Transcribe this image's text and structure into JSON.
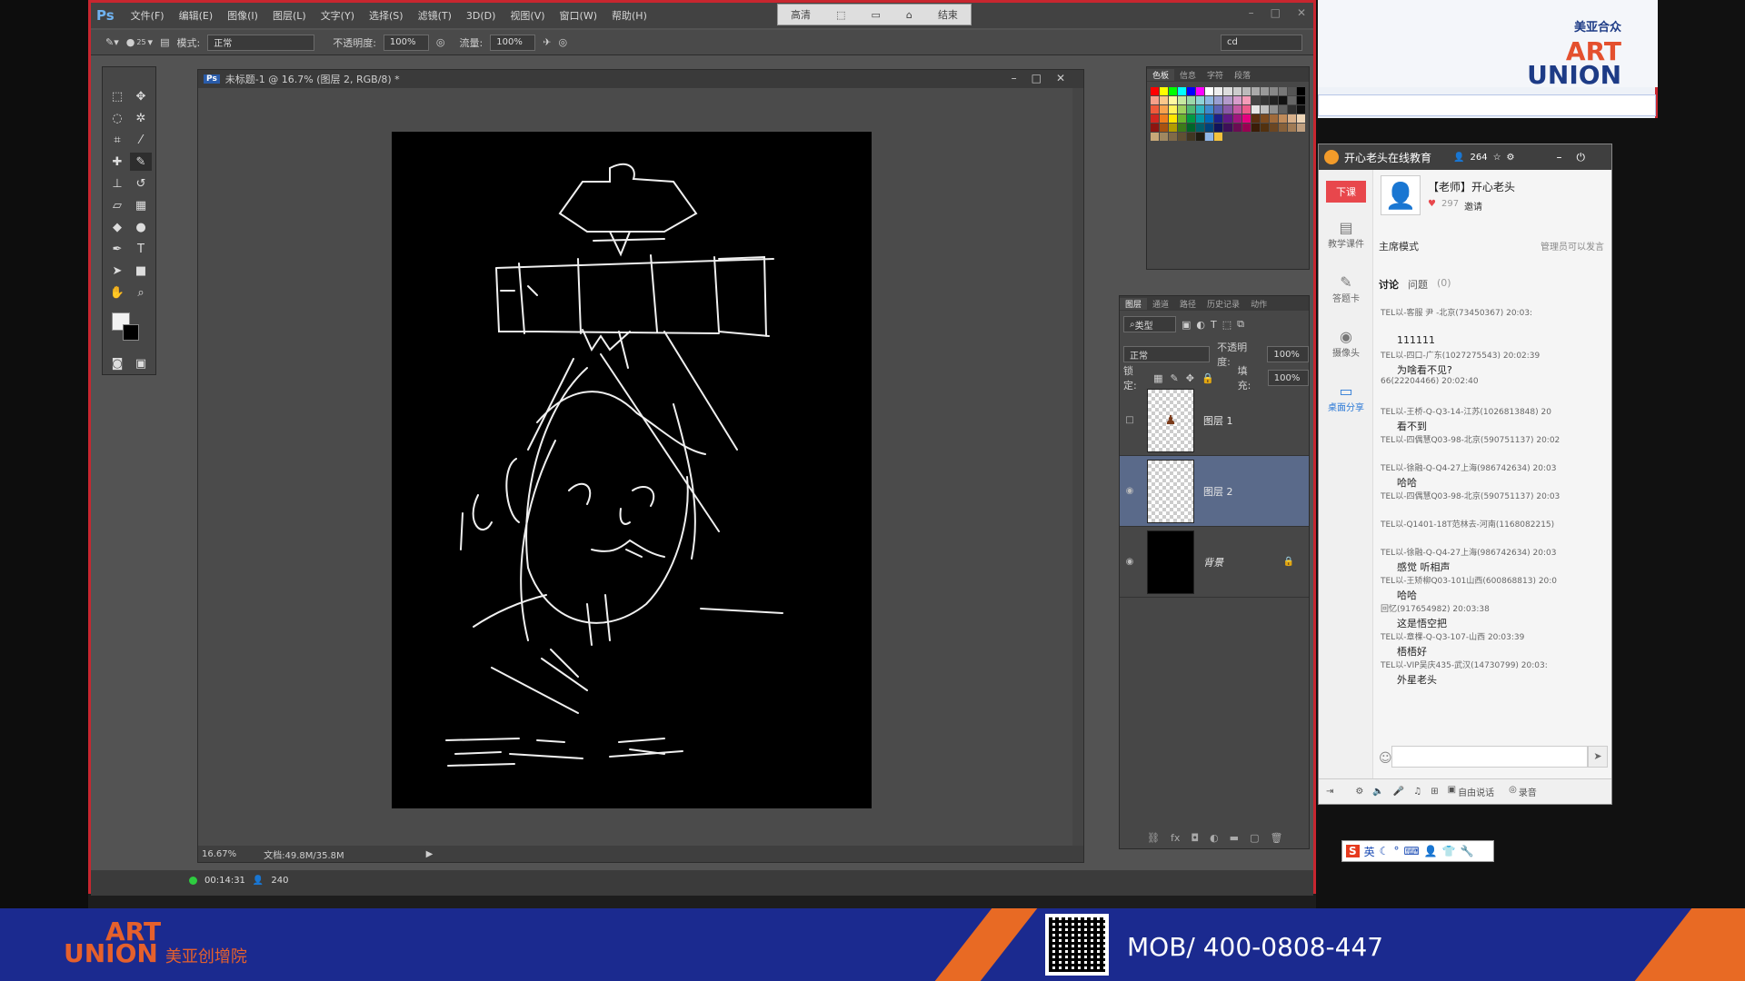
{
  "menu": {
    "app_logo": "Ps",
    "items": [
      "文件(F)",
      "编辑(E)",
      "图像(I)",
      "图层(L)",
      "文字(Y)",
      "选择(S)",
      "滤镜(T)",
      "3D(D)",
      "视图(V)",
      "窗口(W)",
      "帮助(H)"
    ],
    "window_min": "–",
    "window_max": "□",
    "window_close": "✕"
  },
  "recorder": {
    "quality": "高清",
    "end": "结束"
  },
  "options": {
    "mode_label": "模式:",
    "mode_value": "正常",
    "opacity_label": "不透明度:",
    "opacity_value": "100%",
    "flow_label": "流量:",
    "flow_value": "100%",
    "brush_size": "25",
    "workspace_value": "cd"
  },
  "document": {
    "title": "未标题-1 @ 16.7% (图层 2, RGB/8) *",
    "zoom": "16.67%",
    "doc_size": "文档:49.8M/35.8M"
  },
  "swatches": {
    "tabs": [
      "色板",
      "信息",
      "字符",
      "段落"
    ],
    "colors": [
      "#ff0000",
      "#ffff00",
      "#00ff00",
      "#00ffff",
      "#0000ff",
      "#ff00ff",
      "#ffffff",
      "#eeeeee",
      "#dddddd",
      "#cccccc",
      "#bbbbbb",
      "#aaaaaa",
      "#999999",
      "#888888",
      "#777777",
      "#555555",
      "#000000",
      "#f7a08a",
      "#fbc78a",
      "#fff9a1",
      "#c7e9a0",
      "#9bd7a8",
      "#8fd3d6",
      "#8db7e0",
      "#9a9fd2",
      "#b39acb",
      "#d79ccb",
      "#f49cb8",
      "#444444",
      "#333333",
      "#222222",
      "#111111",
      "#666666",
      "#000000",
      "#ef5a3b",
      "#f7a24e",
      "#fff25b",
      "#9fd05f",
      "#4fb872",
      "#2fb5bf",
      "#3f8bce",
      "#5d63b4",
      "#8a5aa8",
      "#c45aa3",
      "#ec5a8a",
      "#e6e6e6",
      "#c0c0c0",
      "#909090",
      "#606060",
      "#303030",
      "#101010",
      "#d1261f",
      "#ee7d1d",
      "#ffe600",
      "#6ab52f",
      "#009944",
      "#0096a6",
      "#0068b7",
      "#1d2088",
      "#601986",
      "#a0167e",
      "#e4007f",
      "#5a2e0f",
      "#7c4a1e",
      "#a06a3a",
      "#c08b5a",
      "#d8b08a",
      "#eed6b8",
      "#8d1510",
      "#a85210",
      "#b29c00",
      "#3c7a1a",
      "#00652a",
      "#005e6b",
      "#00427a",
      "#10135a",
      "#3d0f58",
      "#6a0c53",
      "#980052",
      "#3b1d07",
      "#52310f",
      "#6b4622",
      "#86603a",
      "#a07b55",
      "#c0a080",
      "#c8a878",
      "#a08860",
      "#806a48",
      "#605034",
      "#403622",
      "#201c12",
      "#8fb7e8",
      "#f3c23c",
      "#474747",
      "#474747",
      "#474747",
      "#474747",
      "#474747",
      "#474747",
      "#474747",
      "#474747",
      "#474747"
    ]
  },
  "layers": {
    "tabs": [
      "图层",
      "通道",
      "路径",
      "历史记录",
      "动作"
    ],
    "filter_label": "类型",
    "blend_value": "正常",
    "opacity_label": "不透明度:",
    "opacity_value": "100%",
    "lock_label": "锁定:",
    "fill_label": "填充:",
    "fill_value": "100%",
    "items": [
      {
        "name": "图层 1"
      },
      {
        "name": "图层 2"
      },
      {
        "name": "背景"
      }
    ]
  },
  "status": {
    "timer": "00:14:31",
    "viewers": "240"
  },
  "brand": {
    "cn": "美亚合众",
    "en_top": "ART",
    "en_bottom": "UNION"
  },
  "chat": {
    "title": "开心老头在线教育",
    "count": "264",
    "class_button": "下课",
    "left_items": [
      "教学课件",
      "答题卡",
      "摄像头",
      "桌面分享"
    ],
    "teacher_name": "【老师】开心老头",
    "likes": "297",
    "invite": "邀请",
    "mode": "主席模式",
    "admin_note": "管理员可以发言",
    "tab_discuss": "讨论",
    "tab_question": "问题",
    "tab_question_count": "(0)",
    "messages": [
      {
        "meta": "TEL以-客服 尹 -北京(73450367) 20:03:",
        "text": ""
      },
      {
        "meta": "",
        "text": "111111"
      },
      {
        "meta": "TEL以-四口-广东(1027275543) 20:02:39",
        "text": "为啥看不见?"
      },
      {
        "meta": "66(22204466) 20:02:40",
        "text": ""
      },
      {
        "meta": "TEL以-王桥-Q-Q3-14-江苏(1026813848) 20",
        "text": "看不到"
      },
      {
        "meta": "TEL以-四偶慧Q03-98-北京(590751137) 20:02",
        "text": ""
      },
      {
        "meta": "TEL以-徐融-Q-Q4-27上海(986742634) 20:03",
        "text": "哈哈"
      },
      {
        "meta": "TEL以-四偶慧Q03-98-北京(590751137) 20:03",
        "text": ""
      },
      {
        "meta": "TEL以-Q1401-18T范林去-河南(1168082215)",
        "text": ""
      },
      {
        "meta": "TEL以-徐融-Q-Q4-27上海(986742634) 20:03",
        "text": "感觉 听相声"
      },
      {
        "meta": "TEL以-王矫柳Q03-101山西(600868813) 20:0",
        "text": "哈哈"
      },
      {
        "meta": "回忆(917654982) 20:03:38",
        "text": "这是悟空把"
      },
      {
        "meta": "TEL以-章棵-Q-Q3-107-山西 20:03:39",
        "text": "梧梧好"
      },
      {
        "meta": "TEL以-VIP吴庆435-武汉(14730799) 20:03:",
        "text": "外星老头"
      }
    ],
    "bottom_free": "自由说话",
    "bottom_record": "录音"
  },
  "ime": {
    "lang": "英"
  },
  "footer": {
    "brand_cn": "美亚创增院",
    "en_top": "ART",
    "en_bottom": "UNION",
    "phone": "MOB/ 400-0808-447"
  }
}
